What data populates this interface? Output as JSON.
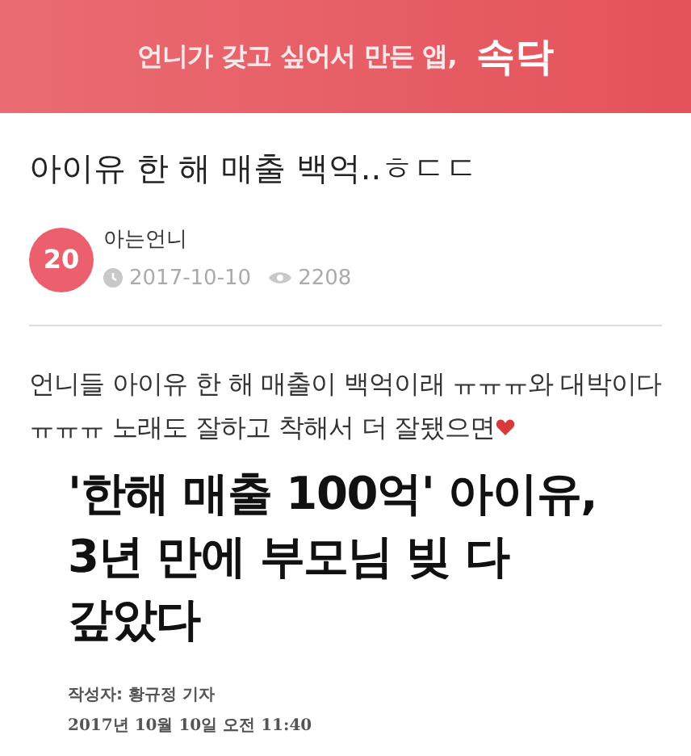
{
  "banner": {
    "tagline": "언니가 갖고 싶어서 만든 앱,",
    "brand": "속닥"
  },
  "post": {
    "title": "아이유 한 해 매출 백억..ㅎㄷㄷ",
    "author": {
      "badge": "20",
      "name": "아는언니"
    },
    "date": "2017-10-10",
    "views": "2208",
    "body": "언니들 아이유 한 해 매출이 백억이래 ㅠㅠㅠ와 대박이다 ㅠㅠㅠ 노래도 잘하고 착해서 더 잘됐으면"
  },
  "article_image": {
    "headline": "'한해 매출 100억' 아이유, 3년 만에 부모님 빚 다 갚았다",
    "byline": "작성자: 황규정 기자",
    "timestamp": "2017년 10월 10일 오전 11:40"
  }
}
